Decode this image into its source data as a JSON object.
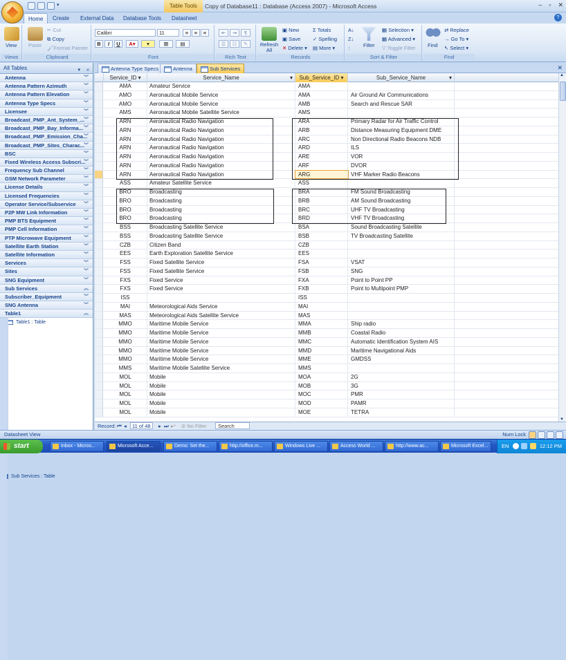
{
  "title": {
    "window": "Copy of Database11 : Database (Access 2007) - Microsoft Access",
    "table_tools": "Table Tools"
  },
  "ribbon_tabs": [
    "Home",
    "Create",
    "External Data",
    "Database Tools",
    "Datasheet"
  ],
  "ribbon": {
    "views": {
      "view": "View",
      "group": "Views"
    },
    "clipboard": {
      "paste": "Paste",
      "cut": "Cut",
      "copy": "Copy",
      "format_painter": "Format Painter",
      "group": "Clipboard"
    },
    "font": {
      "name": "Calibri",
      "size": "11",
      "group": "Font"
    },
    "rich_text": {
      "group": "Rich Text"
    },
    "records": {
      "refresh": "Refresh All",
      "new": "New",
      "save": "Save",
      "delete": "Delete",
      "totals": "Totals",
      "spelling": "Spelling",
      "more": "More",
      "group": "Records"
    },
    "sort_filter": {
      "filter": "Filter",
      "selection": "Selection",
      "advanced": "Advanced",
      "toggle": "Toggle Filter",
      "group": "Sort & Filter"
    },
    "find": {
      "find": "Find",
      "replace": "Replace",
      "goto": "Go To",
      "select": "Select",
      "group": "Find"
    }
  },
  "nav": {
    "header": "All Tables",
    "items": [
      {
        "type": "group",
        "label": "Antenna"
      },
      {
        "type": "group",
        "label": "Antenna Pattern Azimuth"
      },
      {
        "type": "group",
        "label": "Antenna Pattern Elevation"
      },
      {
        "type": "group",
        "label": "Antenna Type Specs"
      },
      {
        "type": "group",
        "label": "Licensee"
      },
      {
        "type": "group",
        "label": "Broadcast_PMP_Ant_System_..."
      },
      {
        "type": "group",
        "label": "Broadcast_PMP_Bay_Informa..."
      },
      {
        "type": "group",
        "label": "Broadcast_PMP_Emission_Cha..."
      },
      {
        "type": "group",
        "label": "Broadcast_PMP_Sites_Charac..."
      },
      {
        "type": "group",
        "label": "BSC"
      },
      {
        "type": "group",
        "label": "Fixed Wireless Access Subscri..."
      },
      {
        "type": "group",
        "label": "Frequency Sub Channel"
      },
      {
        "type": "group",
        "label": "GSM Network Parameter"
      },
      {
        "type": "group",
        "label": "License Details"
      },
      {
        "type": "group",
        "label": "Licensed Frequencies"
      },
      {
        "type": "group",
        "label": "Operator Service/Subservice"
      },
      {
        "type": "group",
        "label": "P2P MW Link Information"
      },
      {
        "type": "group",
        "label": "PMP BTS Equipment"
      },
      {
        "type": "group",
        "label": "PMP Cell Information"
      },
      {
        "type": "group",
        "label": "PTP Microwave Equipment"
      },
      {
        "type": "group",
        "label": "Satellite Earth Station"
      },
      {
        "type": "group",
        "label": "Satellite Information"
      },
      {
        "type": "group",
        "label": "Services"
      },
      {
        "type": "group",
        "label": "Sites"
      },
      {
        "type": "group",
        "label": "SNG Equipment"
      },
      {
        "type": "group",
        "label": "Sub Services",
        "open": true
      },
      {
        "type": "item",
        "label": "Sub Services : Table",
        "selected": true
      },
      {
        "type": "group",
        "label": "Subscriber_Equipment"
      },
      {
        "type": "group",
        "label": "SNG Antenna"
      },
      {
        "type": "group",
        "label": "Table1",
        "open": true
      },
      {
        "type": "item",
        "label": "Table1 : Table"
      }
    ]
  },
  "doc_tabs": [
    "Antenna Type Specs",
    "Antenna",
    "Sub Services"
  ],
  "columns": [
    "Service_ID",
    "Service_Name",
    "Sub_Service_ID",
    "Sub_Service_Name"
  ],
  "rows": [
    [
      "AMA",
      "Amateur Service",
      "AMA",
      ""
    ],
    [
      "AMO",
      "Aeronautical Mobile Service",
      "AMA",
      "Air Ground Air Communications"
    ],
    [
      "AMO",
      "Aeronautical Mobile Service",
      "AMB",
      "Search and Rescue SAR"
    ],
    [
      "AMS",
      "Aeronautical Mobile Satellite Service",
      "AMS",
      ""
    ],
    [
      "ARN",
      "Aeronautical Radio Navigation",
      "ARA",
      "Primary Radar for Air Traffic Control"
    ],
    [
      "ARN",
      "Aeronautical Radio Navigation",
      "ARB",
      "Distance Measuring Equipment DME"
    ],
    [
      "ARN",
      "Aeronautical Radio Navigation",
      "ARC",
      "Non Directional Radio Beacons NDB"
    ],
    [
      "ARN",
      "Aeronautical Radio Navigation",
      "ARD",
      "ILS"
    ],
    [
      "ARN",
      "Aeronautical Radio Navigation",
      "ARE",
      "VOR"
    ],
    [
      "ARN",
      "Aeronautical Radio Navigation",
      "ARF",
      "DVOR"
    ],
    [
      "ARN",
      "Aeronautical Radio Navigation",
      "ARG",
      "VHF Marker Radio Beacons"
    ],
    [
      "ASS",
      "Amateur Satellite Service",
      "ASS",
      ""
    ],
    [
      "BRO",
      "Broadcasting",
      "BRA",
      "FM Sound Broadcasting"
    ],
    [
      "BRO",
      "Broadcasting",
      "BRB",
      "AM Sound Broadcasting"
    ],
    [
      "BRO",
      "Broadcasting",
      "BRC",
      "UHF TV Broadcasting"
    ],
    [
      "BRO",
      "Broadcasting",
      "BRD",
      "VHF TV Broadcasting"
    ],
    [
      "BSS",
      "Broadcasting Satellite Service",
      "BSA",
      "Sound Broadcasting Satellite"
    ],
    [
      "BSS",
      "Broadcasting Satellite Service",
      "BSB",
      "TV Broadcasting Satellite"
    ],
    [
      "CZB",
      "Citizen Band",
      "CZB",
      ""
    ],
    [
      "EES",
      "Earth Exploration Satellite Service",
      "EES",
      ""
    ],
    [
      "FSS",
      "Fixed Satellite Service",
      "FSA",
      "VSAT"
    ],
    [
      "FSS",
      "Fixed Satellite Service",
      "FSB",
      "SNG"
    ],
    [
      "FXS",
      "Fixed Service",
      "FXA",
      "Point to Point PP"
    ],
    [
      "FXS",
      "Fixed Service",
      "FXB",
      "Point to Multipoint PMP"
    ],
    [
      "ISS",
      "",
      "ISS",
      ""
    ],
    [
      "MAI",
      "Meteorological Aids Service",
      "MAI",
      ""
    ],
    [
      "MAS",
      "Meteorological Aids Satellite Service",
      "MAS",
      ""
    ],
    [
      "MMO",
      "Maritime Mobile Service",
      "MMA",
      "Ship radio"
    ],
    [
      "MMO",
      "Maritime Mobile Service",
      "MMB",
      "Coastal Radio"
    ],
    [
      "MMO",
      "Maritime Mobile Service",
      "MMC",
      "Automatic Identification System AIS"
    ],
    [
      "MMO",
      "Maritime Mobile Service",
      "MMD",
      "Maritime Navigational Aids"
    ],
    [
      "MMO",
      "Maritime Mobile Service",
      "MME",
      "GMDSS"
    ],
    [
      "MMS",
      "Maritime Mobile Satellite Service",
      "MMS",
      ""
    ],
    [
      "MOL",
      "Mobile",
      "MOA",
      "2G"
    ],
    [
      "MOL",
      "Mobile",
      "MOB",
      "3G"
    ],
    [
      "MOL",
      "Mobile",
      "MOC",
      "PMR"
    ],
    [
      "MOL",
      "Mobile",
      "MOD",
      "PAMR"
    ],
    [
      "MOL",
      "Mobile",
      "MOE",
      "TETRA"
    ]
  ],
  "current_row": 10,
  "record_nav": {
    "label": "Record:",
    "position": "11 of 48",
    "filter": "No Filter",
    "search": "Search"
  },
  "status": {
    "left": "Datasheet View",
    "right": "Num Lock"
  },
  "taskbar": {
    "start": "start",
    "tasks": [
      "Inbox - Micros...",
      "Microsoft Acce...",
      "Demo: Set the...",
      "http://office.m...",
      "Windows Live ...",
      "Access World ...",
      "http://www.ac...",
      "Microsoft Excel..."
    ],
    "lang": "EN",
    "clock": "12:12 PM"
  }
}
